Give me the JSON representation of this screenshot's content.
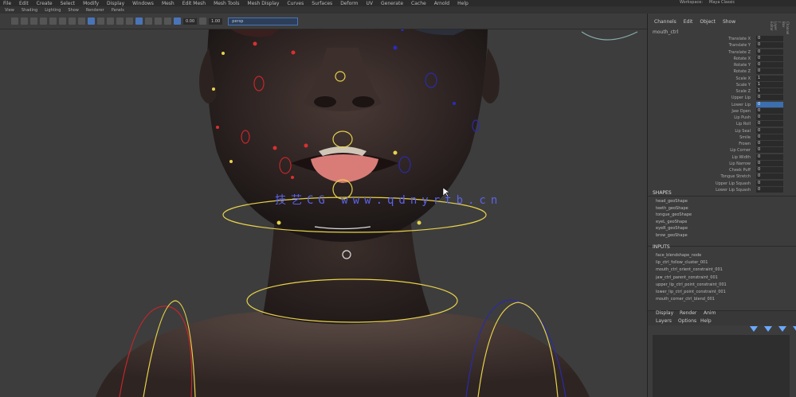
{
  "menubar": {
    "items": [
      "File",
      "Edit",
      "Create",
      "Select",
      "Modify",
      "Display",
      "Windows",
      "Mesh",
      "Edit Mesh",
      "Mesh Tools",
      "Mesh Display",
      "Curves",
      "Surfaces",
      "Deform",
      "UV",
      "Generate",
      "Cache",
      "Arnold",
      "Help"
    ]
  },
  "statusbar": {
    "items": [
      "View",
      "Shading",
      "Lighting",
      "Show",
      "Renderer",
      "Panels"
    ]
  },
  "toolbar": {
    "field_value": "0.00",
    "field_value2": "1.00",
    "camera_dropdown": "persp"
  },
  "workspace_tabs": [
    "Workspace:",
    "Maya Classic"
  ],
  "channel_box": {
    "menu": [
      "Channels",
      "Edit",
      "Object",
      "Show"
    ],
    "object_name": "mouth_ctrl",
    "attributes": [
      {
        "label": "Translate X",
        "value": "0"
      },
      {
        "label": "Translate Y",
        "value": "0"
      },
      {
        "label": "Translate Z",
        "value": "0"
      },
      {
        "label": "Rotate X",
        "value": "0"
      },
      {
        "label": "Rotate Y",
        "value": "0"
      },
      {
        "label": "Rotate Z",
        "value": "0"
      },
      {
        "label": "Scale X",
        "value": "1"
      },
      {
        "label": "Scale Y",
        "value": "1"
      },
      {
        "label": "Scale Z",
        "value": "1"
      },
      {
        "label": "Upper Lip",
        "value": "0"
      },
      {
        "label": "Lower Lip",
        "value": "0"
      },
      {
        "label": "Jaw Open",
        "value": "0"
      },
      {
        "label": "Lip Push",
        "value": "0"
      },
      {
        "label": "Lip Roll",
        "value": "0"
      },
      {
        "label": "Lip Seal",
        "value": "0"
      },
      {
        "label": "Smile",
        "value": "0"
      },
      {
        "label": "Frown",
        "value": "0"
      },
      {
        "label": "Lip Corner",
        "value": "0"
      },
      {
        "label": "Lip Width",
        "value": "0"
      },
      {
        "label": "Lip Narrow",
        "value": "0"
      },
      {
        "label": "Cheek Puff",
        "value": "0"
      },
      {
        "label": "Tongue Stretch",
        "value": "0"
      },
      {
        "label": "Upper Lip Squash",
        "value": "0"
      },
      {
        "label": "Lower Lip Squash",
        "value": "0"
      }
    ],
    "selected_index": 10,
    "shapes_header": "SHAPES",
    "shapes": [
      "head_geoShape",
      "teeth_geoShape",
      "tongue_geoShape",
      "eyeL_geoShape",
      "eyeR_geoShape",
      "brow_geoShape"
    ],
    "inputs_header": "INPUTS",
    "inputs": [
      "face_blendshape_node",
      "lip_ctrl_follow_cluster_001",
      "mouth_ctrl_orient_constraint_001",
      "jaw_ctrl_parent_constraint_001",
      "upper_lip_ctrl_point_constraint_001",
      "lower_lip_ctrl_point_constraint_001",
      "mouth_corner_ctrl_blend_001"
    ],
    "bottom_tabs": [
      "Display",
      "Render",
      "Anim"
    ],
    "bottom_sub": [
      "Layers",
      "Options",
      "Help"
    ]
  },
  "watermark": "技艺CG www.qdnyrtb.cn"
}
